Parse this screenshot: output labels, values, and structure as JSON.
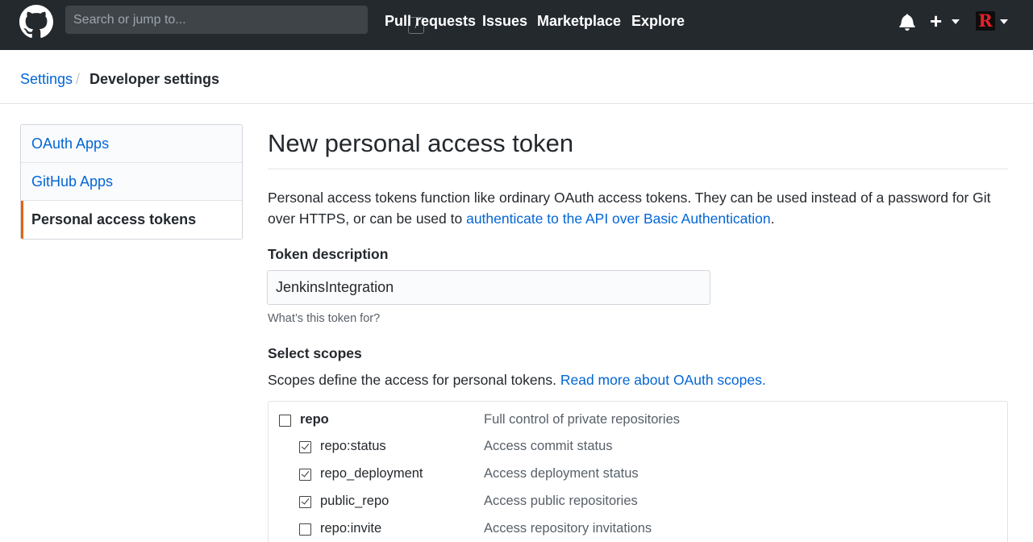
{
  "header": {
    "search_placeholder": "Search or jump to...",
    "search_shortcut": "/",
    "nav": [
      "Pull requests",
      "Issues",
      "Marketplace",
      "Explore"
    ],
    "avatar_letter": "R"
  },
  "breadcrumb": {
    "parent": "Settings",
    "separator": "/",
    "current": "Developer settings"
  },
  "sidebar": {
    "items": [
      {
        "label": "OAuth Apps",
        "selected": false
      },
      {
        "label": "GitHub Apps",
        "selected": false
      },
      {
        "label": "Personal access tokens",
        "selected": true
      }
    ],
    "accent": "#e36209"
  },
  "main": {
    "title": "New personal access token",
    "intro_text": "Personal access tokens function like ordinary OAuth access tokens. They can be used instead of a password for Git over HTTPS, or can be used to ",
    "intro_link": "authenticate to the API over Basic Authentication",
    "intro_end": ".",
    "token_label": "Token description",
    "token_value": "JenkinsIntegration",
    "token_note": "What’s this token for?",
    "scopes_label": "Select scopes",
    "scopes_text": "Scopes define the access for personal tokens. ",
    "scopes_link": "Read more about OAuth scopes.",
    "scopes": [
      {
        "name": "repo",
        "description": "Full control of private repositories",
        "checked": false,
        "level": 0
      },
      {
        "name": "repo:status",
        "description": "Access commit status",
        "checked": true,
        "level": 1
      },
      {
        "name": "repo_deployment",
        "description": "Access deployment status",
        "checked": true,
        "level": 1
      },
      {
        "name": "public_repo",
        "description": "Access public repositories",
        "checked": true,
        "level": 1
      },
      {
        "name": "repo:invite",
        "description": "Access repository invitations",
        "checked": false,
        "level": 1
      }
    ]
  },
  "colors": {
    "header_bg": "#24292e",
    "link": "#0366d6",
    "border": "#e1e4e8"
  }
}
